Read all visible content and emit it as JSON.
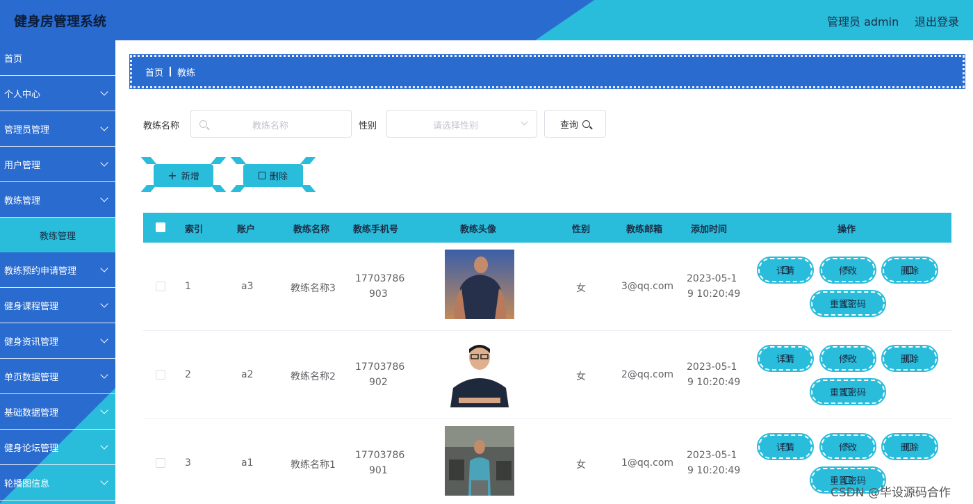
{
  "header": {
    "title": "健身房管理系统",
    "user_label": "管理员 admin",
    "logout_label": "退出登录"
  },
  "sidebar": {
    "items": [
      {
        "label": "首页",
        "expandable": false
      },
      {
        "label": "个人中心",
        "expandable": true
      },
      {
        "label": "管理员管理",
        "expandable": true
      },
      {
        "label": "用户管理",
        "expandable": true
      },
      {
        "label": "教练管理",
        "expandable": true
      },
      {
        "label": "教练管理",
        "sub": true
      },
      {
        "label": "教练预约申请管理",
        "expandable": true
      },
      {
        "label": "健身课程管理",
        "expandable": true
      },
      {
        "label": "健身资讯管理",
        "expandable": true
      },
      {
        "label": "单页数据管理",
        "expandable": true
      },
      {
        "label": "基础数据管理",
        "expandable": true
      },
      {
        "label": "健身论坛管理",
        "expandable": true
      },
      {
        "label": "轮播图信息",
        "expandable": true
      }
    ]
  },
  "breadcrumb": {
    "home": "首页",
    "current": "教练"
  },
  "search": {
    "name_label": "教练名称",
    "name_placeholder": "教练名称",
    "gender_label": "性别",
    "gender_placeholder": "请选择性别",
    "query_label": "查询"
  },
  "actions": {
    "add_label": "新增",
    "delete_label": "删除"
  },
  "table": {
    "headers": [
      "索引",
      "账户",
      "教练名称",
      "教练手机号",
      "教练头像",
      "性别",
      "教练邮箱",
      "添加时间",
      "操作"
    ],
    "rows": [
      {
        "index": "1",
        "account": "a3",
        "name": "教练名称3",
        "phone_line1": "17703786",
        "phone_line2": "903",
        "gender": "女",
        "email": "3@qq.com",
        "time_line1": "2023-05-1",
        "time_line2": "9 10:20:49"
      },
      {
        "index": "2",
        "account": "a2",
        "name": "教练名称2",
        "phone_line1": "17703786",
        "phone_line2": "902",
        "gender": "女",
        "email": "2@qq.com",
        "time_line1": "2023-05-1",
        "time_line2": "9 10:20:49"
      },
      {
        "index": "3",
        "account": "a1",
        "name": "教练名称1",
        "phone_line1": "17703786",
        "phone_line2": "901",
        "gender": "女",
        "email": "1@qq.com",
        "time_line1": "2023-05-1",
        "time_line2": "9 10:20:49"
      }
    ],
    "ops": {
      "detail": "详情",
      "edit": "修改",
      "delete": "删除",
      "reset": "重置密码"
    }
  },
  "watermark": "CSDN @毕设源码合作",
  "colors": {
    "primary_blue": "#2a6bcf",
    "accent_cyan": "#29bcdb"
  }
}
